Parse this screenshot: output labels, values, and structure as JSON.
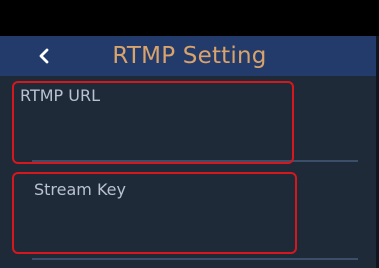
{
  "header": {
    "title": "RTMP Setting",
    "back_glyph": "back-chevron-icon"
  },
  "fields": {
    "rtmp_url": {
      "label": "RTMP URL",
      "value": "",
      "placeholder": ""
    },
    "stream_key": {
      "label": "Stream Key",
      "value": "",
      "placeholder": ""
    }
  },
  "colors": {
    "header_bg": "#233b6a",
    "title": "#d8a36c",
    "content_bg": "#1f2a38",
    "highlight": "#d6171d"
  }
}
